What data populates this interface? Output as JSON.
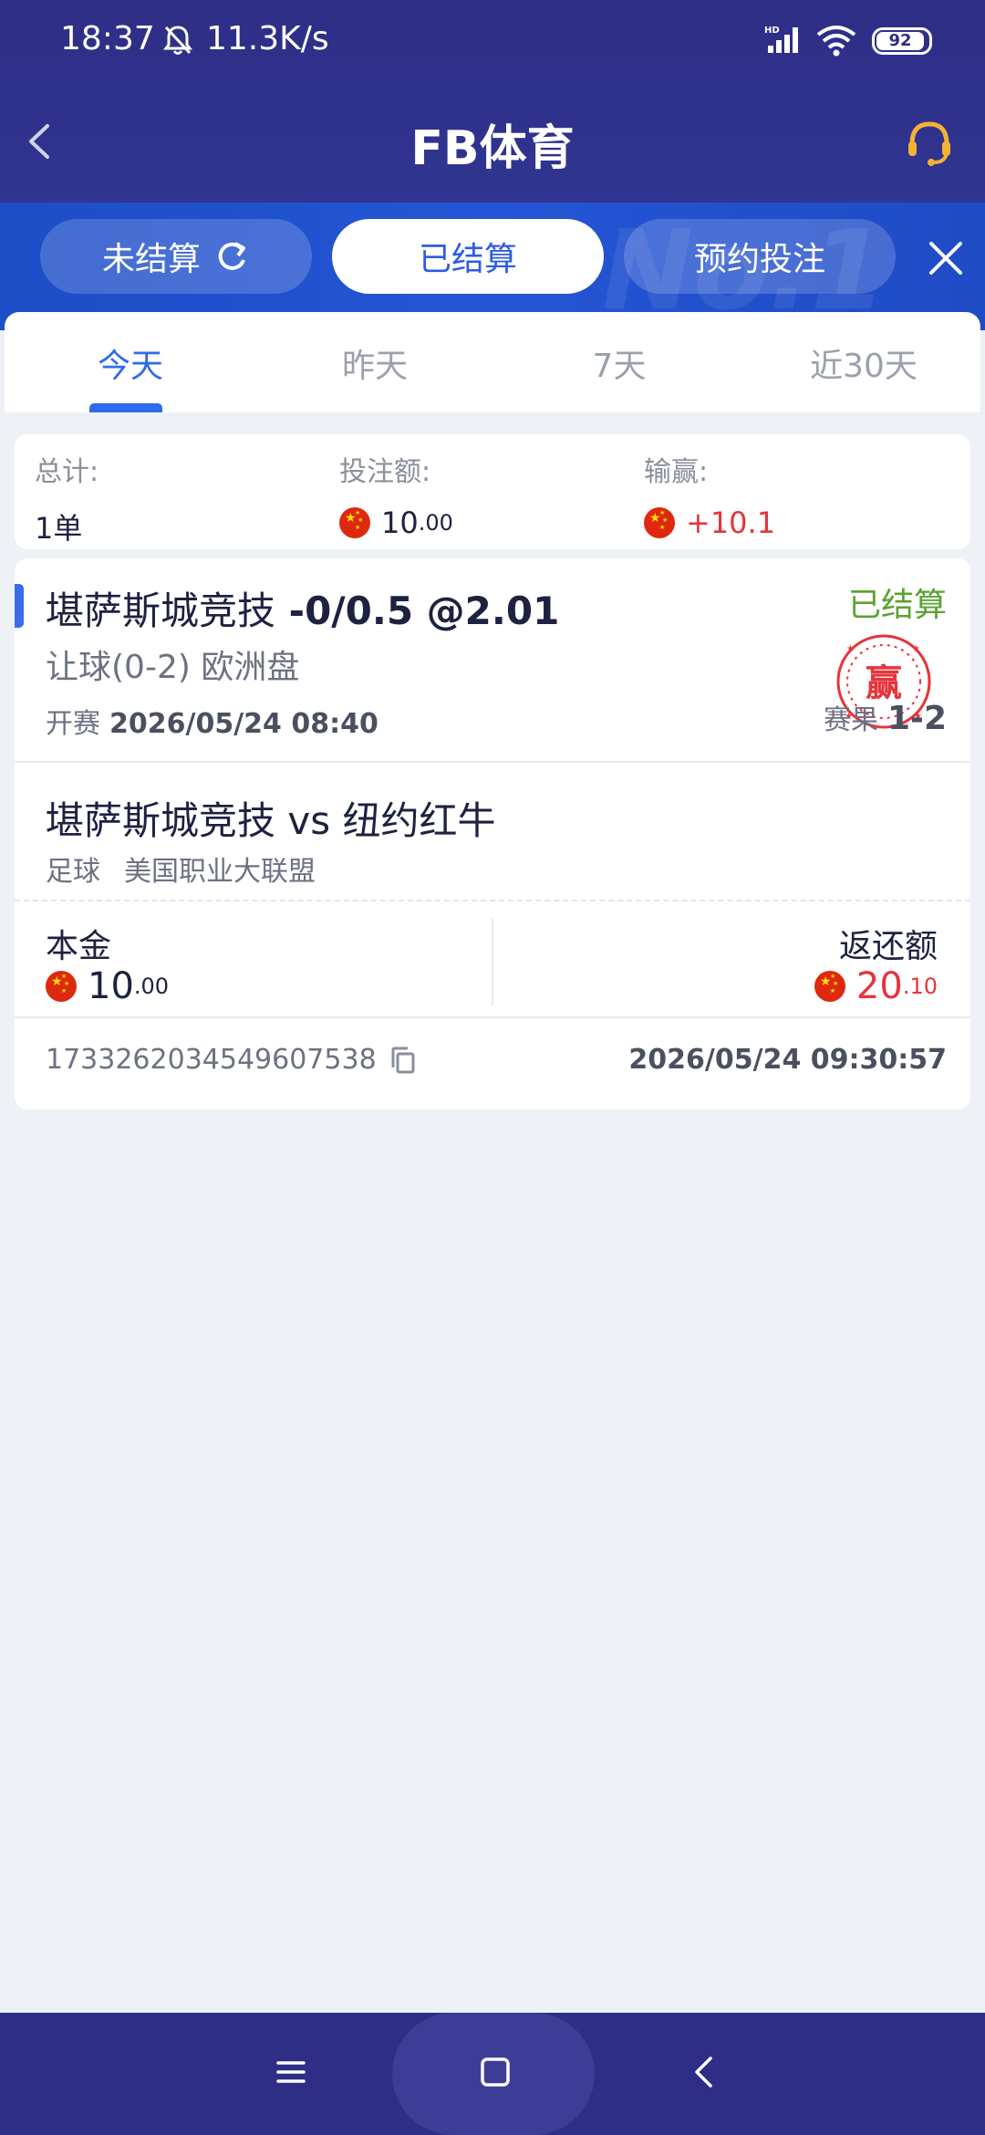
{
  "status_bar": {
    "time": "18:37",
    "speed": "11.3K/s",
    "battery": "92"
  },
  "nav": {
    "title": "FB体育",
    "icons": {
      "back": "chevron-left-icon",
      "service": "customer-service-headset-icon"
    }
  },
  "bet_tabs": {
    "items": [
      {
        "label": "未结算",
        "active": false
      },
      {
        "label": "已结算",
        "active": true
      },
      {
        "label": "预约投注",
        "active": false
      }
    ]
  },
  "period_tabs": {
    "items": [
      {
        "label": "今天",
        "active": true
      },
      {
        "label": "昨天",
        "active": false
      },
      {
        "label": "7天",
        "active": false
      },
      {
        "label": "近30天",
        "active": false
      }
    ]
  },
  "summary": {
    "total_label": "总计:",
    "total_value": "1单",
    "stake_label": "投注额:",
    "stake_int": "10",
    "stake_dec": ".00",
    "winloss_label": "输赢:",
    "winloss_value": "+10.1"
  },
  "bet": {
    "team": "堪萨斯城竞技",
    "handicap": "-0/0.5 @2.01",
    "status": "已结算",
    "market": "让球(0-2) 欧洲盘",
    "start_label": "开赛",
    "start_time": "2026/05/24 08:40",
    "result_label": "赛果",
    "result_score": "1-2",
    "stamp_text": "赢",
    "match_name": "堪萨斯城竞技 vs 纽约红牛",
    "sport": "足球",
    "league": "美国职业大联盟",
    "principal_label": "本金",
    "principal_int": "10",
    "principal_dec": ".00",
    "return_label": "返还额",
    "return_int": "20",
    "return_dec": ".10",
    "order_id": "1733262034549607538",
    "settle_time": "2026/05/24 09:30:57"
  },
  "colors": {
    "header": "#2e2e86",
    "band": "#2455d4",
    "accent": "#2f6bea",
    "win_red": "#e8333b",
    "settled_green": "#5aa332"
  }
}
